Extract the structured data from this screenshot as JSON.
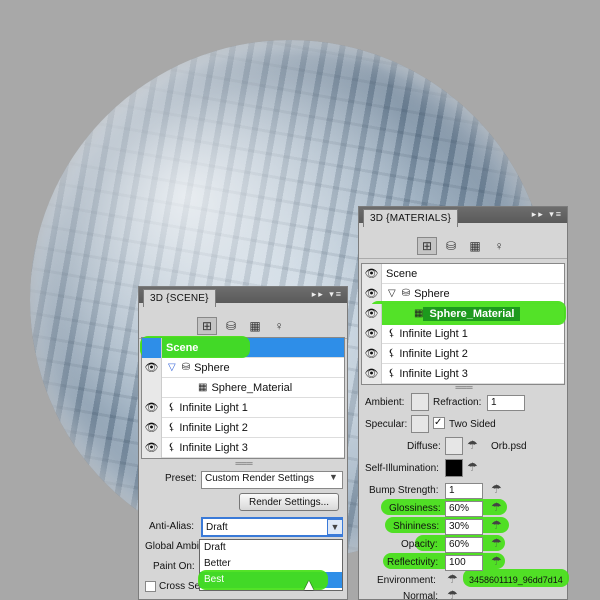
{
  "colors": {
    "highlight": "#44e016",
    "selection": "#2e8ee8",
    "panel_bg": "#d6d6d6",
    "canvas_bg": "#a8a8a8"
  },
  "scene_panel": {
    "tab": "3D {SCENE}",
    "tree": [
      {
        "label": "Scene",
        "icon": "scene",
        "selected": true
      },
      {
        "label": "Sphere",
        "icon": "mesh-icon"
      },
      {
        "label": "Sphere_Material",
        "icon": "material-icon"
      },
      {
        "label": "Infinite Light 1",
        "icon": "light-icon"
      },
      {
        "label": "Infinite Light 2",
        "icon": "light-icon"
      },
      {
        "label": "Infinite Light 3",
        "icon": "light-icon"
      }
    ],
    "preset_label": "Preset:",
    "preset_value": "Custom Render Settings",
    "render_settings_button": "Render Settings...",
    "anti_alias_label": "Anti-Alias:",
    "anti_alias_value": "Draft",
    "anti_alias_options": [
      "Draft",
      "Better",
      "Best"
    ],
    "global_ambient_label": "Global Ambi",
    "paint_on_label": "Paint On:",
    "cross_section_label": "Cross Sect"
  },
  "materials_panel": {
    "tab": "3D {MATERIALS}",
    "tree": [
      {
        "label": "Scene"
      },
      {
        "label": "Sphere"
      },
      {
        "label": "Sphere_Material",
        "highlighted": true
      },
      {
        "label": "Infinite Light 1"
      },
      {
        "label": "Infinite Light 2"
      },
      {
        "label": "Infinite Light 3"
      }
    ],
    "ambient_label": "Ambient:",
    "refraction_label": "Refraction:",
    "refraction_value": "1",
    "specular_label": "Specular:",
    "two_sided_label": "Two Sided",
    "diffuse_label": "Diffuse:",
    "diffuse_file": "Orb.psd",
    "self_illum_label": "Self-Illumination:",
    "bump_label": "Bump Strength:",
    "bump_value": "1",
    "glossiness_label": "Glossiness:",
    "glossiness_value": "60%",
    "shininess_label": "Shininess:",
    "shininess_value": "30%",
    "opacity_label": "Opacity:",
    "opacity_value": "60%",
    "reflectivity_label": "Reflectivity:",
    "reflectivity_value": "100",
    "environment_label": "Environment:",
    "environment_value": "3458601119_96dd7d14",
    "normal_label": "Normal:"
  }
}
